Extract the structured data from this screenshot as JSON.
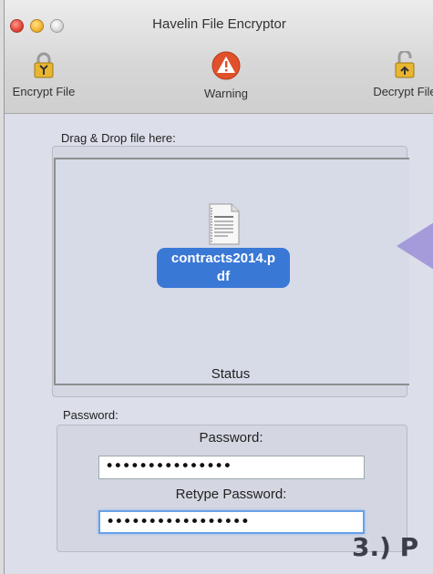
{
  "window": {
    "title": "Havelin File Encryptor"
  },
  "toolbar": {
    "encrypt_label": "Encrypt File",
    "warning_label": "Warning",
    "decrypt_label": "Decrypt File"
  },
  "dropzone": {
    "label": "Drag & Drop file here:",
    "file_name_line1": "contracts2014.p",
    "file_name_line2": "df",
    "status": "Status"
  },
  "password_section": {
    "label": "Password:",
    "password_heading": "Password:",
    "password_value": "•••••••••••••••",
    "retype_heading": "Retype Password:",
    "retype_value": "•••••••••••••••••"
  },
  "overlay": {
    "step_text": "3.) P"
  },
  "colors": {
    "accent": "#3a78d6",
    "warning": "#e0502a",
    "pointer": "#9b8fd8"
  }
}
